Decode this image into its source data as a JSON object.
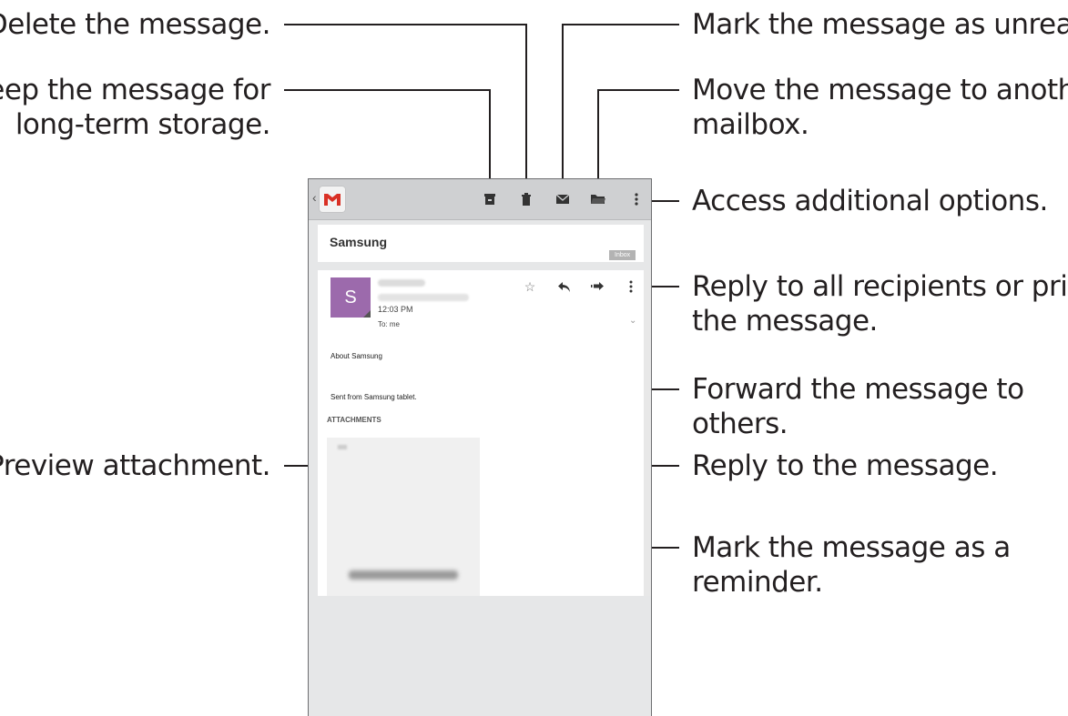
{
  "callouts": {
    "delete": "Delete the message.",
    "keep_line1": "Keep the message for",
    "keep_line2": "long-term storage.",
    "preview": "Preview attachment.",
    "unread": "Mark the message as unread.",
    "move_line1": "Move the message to another",
    "move_line2": "mailbox.",
    "options": "Access additional options.",
    "replyall_line1": "Reply to all recipients or print",
    "replyall_line2": "the message.",
    "forward_line1": "Forward the message to",
    "forward_line2": "others.",
    "reply": "Reply to the message.",
    "reminder_line1": "Mark the message as a",
    "reminder_line2": "reminder."
  },
  "actionbar": {
    "icons": [
      "archive-icon",
      "delete-icon",
      "mark-unread-icon",
      "move-folder-icon",
      "overflow-menu-icon"
    ],
    "back_glyph": "‹"
  },
  "email": {
    "subject": "Samsung",
    "label_badge": "Inbox",
    "avatar_letter": "S",
    "time": "12:03 PM",
    "to": "To: me",
    "body_about": "About Samsung",
    "body_sent": "Sent from Samsung tablet.",
    "attachments_title": "ATTACHMENTS",
    "star_glyph": "☆",
    "expand_glyph": "⌄"
  },
  "colors": {
    "avatar": "#9c6aac",
    "gmail_red": "#d93025",
    "icon_dark": "#333333"
  }
}
